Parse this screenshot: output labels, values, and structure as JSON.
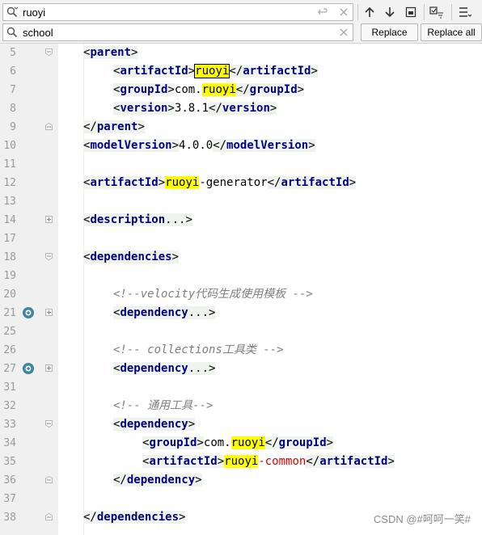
{
  "findbar": {
    "search_value": "ruoyi",
    "replace_value": "school",
    "replace_label": "Replace",
    "replace_all_label": "Replace all"
  },
  "editor": {
    "lines": [
      {
        "num": "5",
        "segs": [
          {
            "t": "<",
            "c": "tg"
          },
          {
            "t": "parent",
            "c": "tg tname"
          },
          {
            "t": ">",
            "c": "tg"
          }
        ]
      },
      {
        "num": "6",
        "segs": [
          {
            "t": "<",
            "c": "tg"
          },
          {
            "t": "artifactId",
            "c": "tg tname"
          },
          {
            "t": ">",
            "c": "tg"
          },
          {
            "t": "ruoyi",
            "c": "hlbox"
          },
          {
            "t": "</",
            "c": "tg"
          },
          {
            "t": "artifactId",
            "c": "tg tname"
          },
          {
            "t": ">",
            "c": "tg"
          }
        ]
      },
      {
        "num": "7",
        "segs": [
          {
            "t": "<",
            "c": "tg"
          },
          {
            "t": "groupId",
            "c": "tg tname"
          },
          {
            "t": ">",
            "c": "tg"
          },
          {
            "t": "com.",
            "c": ""
          },
          {
            "t": "ruoyi",
            "c": "hl"
          },
          {
            "t": "</",
            "c": "tg"
          },
          {
            "t": "groupId",
            "c": "tg tname"
          },
          {
            "t": ">",
            "c": "tg"
          }
        ]
      },
      {
        "num": "8",
        "segs": [
          {
            "t": "<",
            "c": "tg"
          },
          {
            "t": "version",
            "c": "tg tname"
          },
          {
            "t": ">",
            "c": "tg"
          },
          {
            "t": "3.8.1",
            "c": ""
          },
          {
            "t": "</",
            "c": "tg"
          },
          {
            "t": "version",
            "c": "tg tname"
          },
          {
            "t": ">",
            "c": "tg"
          }
        ]
      },
      {
        "num": "9",
        "segs": [
          {
            "t": "</",
            "c": "tg"
          },
          {
            "t": "parent",
            "c": "tg tname"
          },
          {
            "t": ">",
            "c": "tg"
          }
        ]
      },
      {
        "num": "10",
        "segs": [
          {
            "t": "<",
            "c": "tg"
          },
          {
            "t": "modelVersion",
            "c": "tg tname"
          },
          {
            "t": ">",
            "c": "tg"
          },
          {
            "t": "4.0.0",
            "c": ""
          },
          {
            "t": "</",
            "c": "tg"
          },
          {
            "t": "modelVersion",
            "c": "tg tname"
          },
          {
            "t": ">",
            "c": "tg"
          }
        ]
      },
      {
        "num": "11",
        "segs": []
      },
      {
        "num": "12",
        "segs": [
          {
            "t": "<",
            "c": "tg"
          },
          {
            "t": "artifactId",
            "c": "tg tname"
          },
          {
            "t": ">",
            "c": "tg"
          },
          {
            "t": "ruoyi",
            "c": "hl"
          },
          {
            "t": "-generator",
            "c": ""
          },
          {
            "t": "</",
            "c": "tg"
          },
          {
            "t": "artifactId",
            "c": "tg tname"
          },
          {
            "t": ">",
            "c": "tg"
          }
        ]
      },
      {
        "num": "13",
        "segs": []
      },
      {
        "num": "14",
        "segs": [
          {
            "t": "<",
            "c": "tg"
          },
          {
            "t": "description",
            "c": "tg tname"
          },
          {
            "t": "...>",
            "c": "tg"
          }
        ]
      },
      {
        "num": "17",
        "segs": []
      },
      {
        "num": "18",
        "segs": [
          {
            "t": "<",
            "c": "tg"
          },
          {
            "t": "dependencies",
            "c": "tg tname"
          },
          {
            "t": ">",
            "c": "tg"
          }
        ]
      },
      {
        "num": "19",
        "segs": []
      },
      {
        "num": "20",
        "segs": [
          {
            "t": "<!--velocity代码生成使用模板 -->",
            "c": "cmt"
          }
        ]
      },
      {
        "num": "21",
        "segs": [
          {
            "t": "<",
            "c": "tg"
          },
          {
            "t": "dependency",
            "c": "tg tname"
          },
          {
            "t": "...>",
            "c": "tg"
          }
        ]
      },
      {
        "num": "25",
        "segs": []
      },
      {
        "num": "26",
        "segs": [
          {
            "t": "<!-- collections工具类 -->",
            "c": "cmt"
          }
        ]
      },
      {
        "num": "27",
        "segs": [
          {
            "t": "<",
            "c": "tg"
          },
          {
            "t": "dependency",
            "c": "tg tname"
          },
          {
            "t": "...>",
            "c": "tg"
          }
        ]
      },
      {
        "num": "31",
        "segs": []
      },
      {
        "num": "32",
        "segs": [
          {
            "t": "<!-- 通用工具-->",
            "c": "cmt"
          }
        ]
      },
      {
        "num": "33",
        "segs": [
          {
            "t": "<",
            "c": "tg"
          },
          {
            "t": "dependency",
            "c": "tg tname"
          },
          {
            "t": ">",
            "c": "tg"
          }
        ]
      },
      {
        "num": "34",
        "segs": [
          {
            "t": "<",
            "c": "tg"
          },
          {
            "t": "groupId",
            "c": "tg tname"
          },
          {
            "t": ">",
            "c": "tg"
          },
          {
            "t": "com.",
            "c": ""
          },
          {
            "t": "ruoyi",
            "c": "hl"
          },
          {
            "t": "</",
            "c": "tg"
          },
          {
            "t": "groupId",
            "c": "tg tname"
          },
          {
            "t": ">",
            "c": "tg"
          }
        ]
      },
      {
        "num": "35",
        "segs": [
          {
            "t": "<",
            "c": "tg"
          },
          {
            "t": "artifactId",
            "c": "tg tname"
          },
          {
            "t": ">",
            "c": "tg"
          },
          {
            "t": "ruoyi",
            "c": "hl"
          },
          {
            "t": "-common",
            "c": "red"
          },
          {
            "t": "</",
            "c": "tg"
          },
          {
            "t": "artifactId",
            "c": "tg tname"
          },
          {
            "t": ">",
            "c": "tg"
          }
        ]
      },
      {
        "num": "36",
        "segs": [
          {
            "t": "</",
            "c": "tg"
          },
          {
            "t": "dependency",
            "c": "tg tname"
          },
          {
            "t": ">",
            "c": "tg"
          }
        ]
      },
      {
        "num": "37",
        "segs": []
      },
      {
        "num": "38",
        "segs": [
          {
            "t": "</",
            "c": "tg"
          },
          {
            "t": "dependencies",
            "c": "tg tname"
          },
          {
            "t": ">",
            "c": "tg"
          }
        ]
      }
    ]
  },
  "watermark": "CSDN @#呵呵一笑#",
  "colors": {
    "tag_name": "#000080",
    "search_highlight": "#ffff00",
    "comment": "#808080",
    "string_red": "#e00000",
    "gutter_bg": "#f0f0f0"
  },
  "icons": [
    "search-icon",
    "clear-icon",
    "history-icon",
    "arrow-up-icon",
    "arrow-down-icon",
    "select-all-icon",
    "filter-icon",
    "settings-icon",
    "fold-icon",
    "implementation-marker-icon"
  ]
}
